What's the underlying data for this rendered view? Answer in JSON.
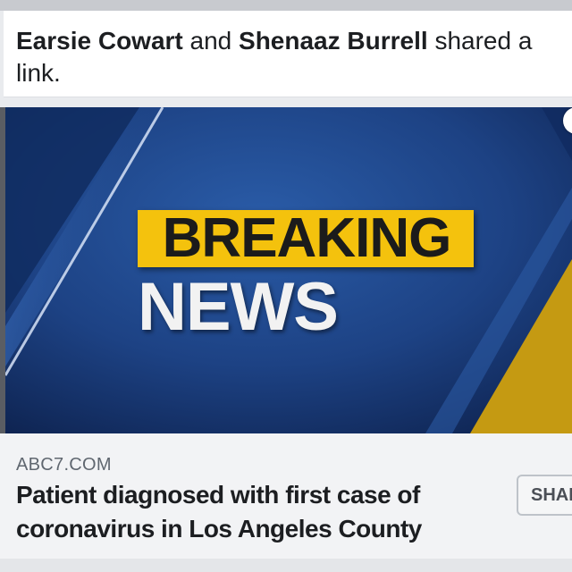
{
  "story": {
    "actor_1": "Earsie Cowart",
    "joiner": "and",
    "actor_2": "Shenaaz Burrell",
    "action": "shared a link."
  },
  "link_image": {
    "banner_line_1": "BREAKING",
    "banner_line_2": "NEWS",
    "colors": {
      "background": "#1b3f7a",
      "accent_yellow": "#f4c20d",
      "text_dark": "#1b1b1b",
      "text_light": "#f2f2f2"
    }
  },
  "link_preview": {
    "domain": "ABC7.COM",
    "headline": "Patient diagnosed with first case of coronavirus in Los Angeles County",
    "share_label": "SHARE"
  }
}
